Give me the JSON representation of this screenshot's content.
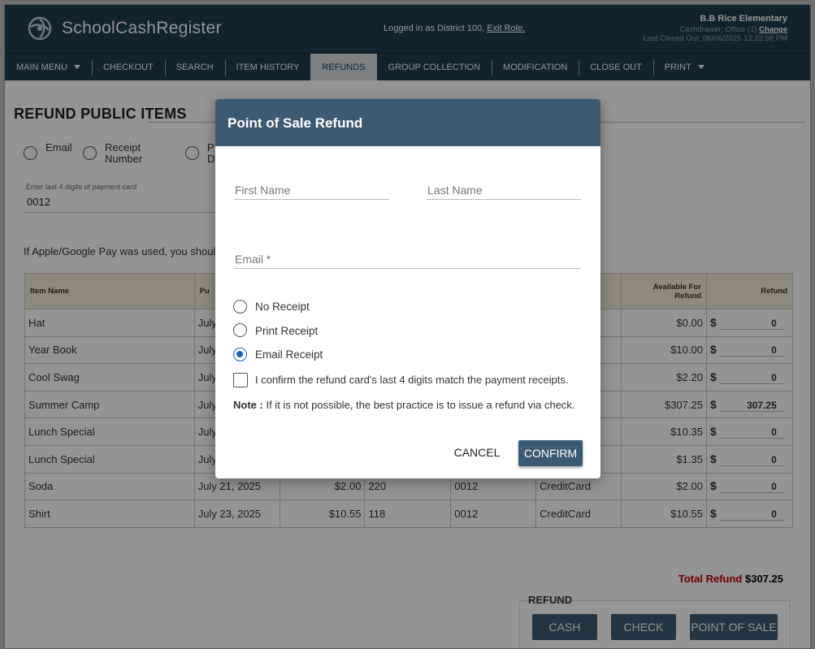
{
  "header": {
    "logo_text": "SchoolCashRegister",
    "login_text": "Logged in as District 100,",
    "exit_role_label": "Exit Role.",
    "school_name": "B.B Rice Elementary",
    "cashdrawer_text": "Cashdrawer: Office (1)",
    "change_label": "Change",
    "last_closed_text": "Last Closed Out: 06/06/2025 12:22:58 PM"
  },
  "nav": {
    "items": [
      {
        "label": "MAIN MENU"
      },
      {
        "label": "CHECKOUT"
      },
      {
        "label": "SEARCH"
      },
      {
        "label": "ITEM HISTORY"
      },
      {
        "label": "REFUNDS"
      },
      {
        "label": "GROUP COLLECTION"
      },
      {
        "label": "MODIFICATION"
      },
      {
        "label": "CLOSE OUT"
      },
      {
        "label": "PRINT"
      }
    ]
  },
  "main": {
    "title": "REFUND PUBLIC ITEMS",
    "search_options": {
      "email": "Email",
      "receipt_line1": "Receipt",
      "receipt_line2": "Number",
      "third_line1": "P",
      "third_line2": "D"
    },
    "card_field_label": "Enter last 4 digits of payment card",
    "card_field_value": "0012",
    "apple_note": "If Apple/Google Pay was used, you should",
    "table": {
      "headers": {
        "item_name": "Item Name",
        "purchased": "Pu",
        "available_line1": "Available For",
        "available_line2": "Refund",
        "refund": "Refund"
      },
      "rows": [
        {
          "item": "Hat",
          "date": "July",
          "amount": "",
          "receipt": "",
          "card": "",
          "method": "",
          "available": "$0.00",
          "refund": "0"
        },
        {
          "item": "Year Book",
          "date": "July",
          "amount": "",
          "receipt": "",
          "card": "",
          "method": "",
          "available": "$10.00",
          "refund": "0"
        },
        {
          "item": "Cool Swag",
          "date": "July",
          "amount": "",
          "receipt": "",
          "card": "",
          "method": "",
          "available": "$2.20",
          "refund": "0"
        },
        {
          "item": "Summer Camp",
          "date": "July",
          "amount": "",
          "receipt": "",
          "card": "",
          "method": "",
          "available": "$307.25",
          "refund": "307.25"
        },
        {
          "item": "Lunch Special",
          "date": "July",
          "amount": "",
          "receipt": "",
          "card": "",
          "method": "",
          "available": "$10.35",
          "refund": "0"
        },
        {
          "item": "Lunch Special",
          "date": "July",
          "amount": "",
          "receipt": "",
          "card": "",
          "method": "",
          "available": "$1.35",
          "refund": "0"
        },
        {
          "item": "Soda",
          "date": "July 21, 2025",
          "amount": "$2.00",
          "receipt": "220",
          "card": "0012",
          "method": "CreditCard",
          "available": "$2.00",
          "refund": "0"
        },
        {
          "item": "Shirt",
          "date": "July 23, 2025",
          "amount": "$10.55",
          "receipt": "118",
          "card": "0012",
          "method": "CreditCard",
          "available": "$10.55",
          "refund": "0"
        }
      ],
      "dollar_sign": "$"
    },
    "total_refund_label": "Total Refund",
    "total_refund_value": "$307.25",
    "refund_section_title": "REFUND",
    "buttons": {
      "cash": "CASH",
      "check": "CHECK",
      "point_of_sale": "POINT OF SALE"
    }
  },
  "modal": {
    "title": "Point of Sale Refund",
    "first_name_label": "First Name",
    "last_name_label": "Last Name",
    "email_label": "Email *",
    "receipt_options": [
      {
        "label": "No Receipt",
        "selected": false
      },
      {
        "label": "Print Receipt",
        "selected": false
      },
      {
        "label": "Email Receipt",
        "selected": true
      }
    ],
    "confirm_checkbox_label": "I confirm the refund card's last 4 digits match the payment receipts.",
    "note_label": "Note :",
    "note_text": "If it is not possible, the best practice is to issue a refund via check.",
    "cancel_label": "CANCEL",
    "confirm_label": "CONFIRM"
  },
  "colors": {
    "header_bg": "#1e3d52",
    "accent": "#3d5a73",
    "radio_selected": "#1565c0",
    "total_label": "#c00000"
  },
  "icons": {
    "logo": "swirl-logo-icon",
    "dropdown": "caret-down-icon"
  }
}
